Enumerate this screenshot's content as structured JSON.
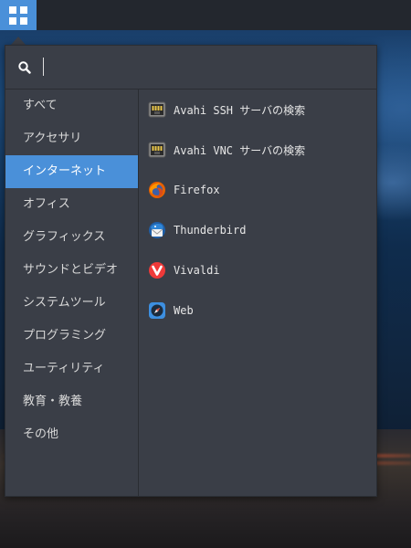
{
  "panel": {
    "menu_icon": "app-grid-icon"
  },
  "search": {
    "value": "",
    "placeholder": "",
    "icon": "search-icon"
  },
  "categories": [
    {
      "label": "すべて",
      "active": false
    },
    {
      "label": "アクセサリ",
      "active": false
    },
    {
      "label": "インターネット",
      "active": true
    },
    {
      "label": "オフィス",
      "active": false
    },
    {
      "label": "グラフィックス",
      "active": false
    },
    {
      "label": "サウンドとビデオ",
      "active": false
    },
    {
      "label": "システムツール",
      "active": false
    },
    {
      "label": "プログラミング",
      "active": false
    },
    {
      "label": "ユーティリティ",
      "active": false
    },
    {
      "label": "教育・教養",
      "active": false
    },
    {
      "label": "その他",
      "active": false
    }
  ],
  "apps": [
    {
      "label": "Avahi SSH サーバの検索",
      "icon": "network-server-icon"
    },
    {
      "label": "Avahi VNC サーバの検索",
      "icon": "network-server-icon"
    },
    {
      "label": "Firefox",
      "icon": "firefox-icon"
    },
    {
      "label": "Thunderbird",
      "icon": "thunderbird-icon"
    },
    {
      "label": "Vivaldi",
      "icon": "vivaldi-icon"
    },
    {
      "label": "Web",
      "icon": "web-browser-icon"
    }
  ],
  "colors": {
    "accent": "#4a90d9",
    "panel_bg": "#23272e",
    "popover_bg": "#3a3e47",
    "text": "#d8d8d8"
  }
}
